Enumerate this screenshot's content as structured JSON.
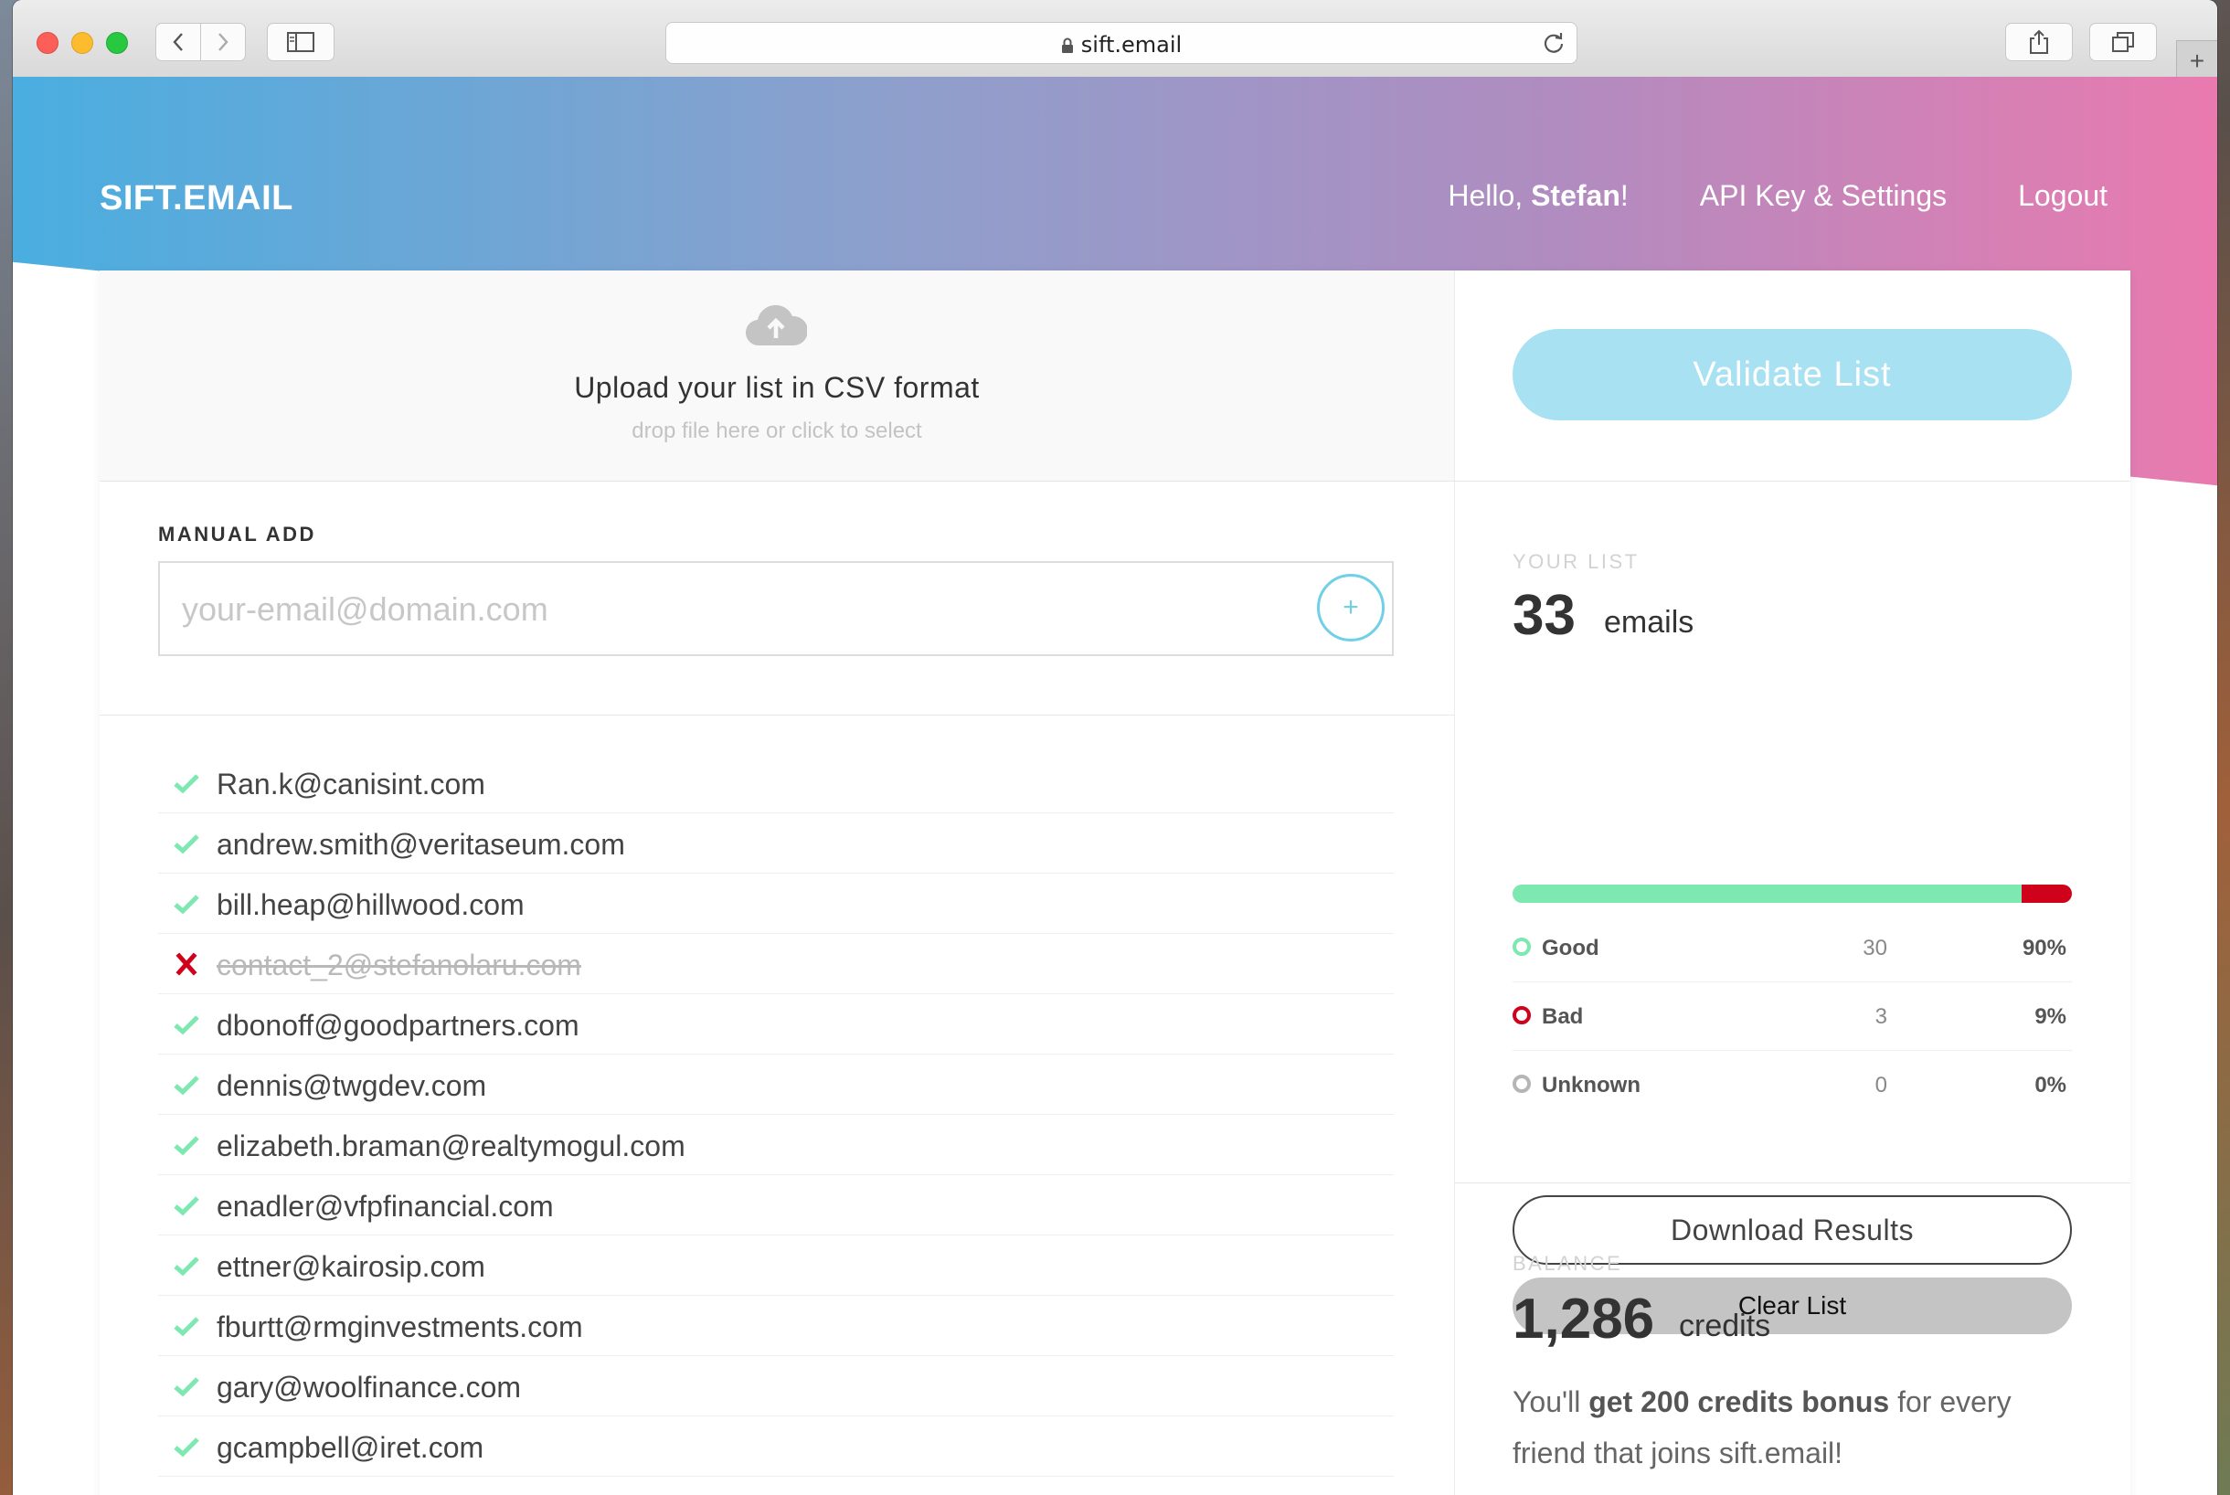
{
  "browser": {
    "url": "sift.email"
  },
  "header": {
    "logo": "SIFT.EMAIL",
    "greeting_prefix": "Hello, ",
    "user_name": "Stefan",
    "greeting_suffix": "!",
    "nav_settings": "API Key & Settings",
    "nav_logout": "Logout"
  },
  "upload": {
    "title": "Upload your list in CSV format",
    "hint": "drop file here or click to select"
  },
  "manual_add": {
    "label": "MANUAL ADD",
    "placeholder": "your-email@domain.com",
    "add_button": "+"
  },
  "emails": [
    {
      "address": "Ran.k@canisint.com",
      "status": "good"
    },
    {
      "address": "andrew.smith@veritaseum.com",
      "status": "good"
    },
    {
      "address": "bill.heap@hillwood.com",
      "status": "good"
    },
    {
      "address": "contact_2@stefanolaru.com",
      "status": "bad"
    },
    {
      "address": "dbonoff@goodpartners.com",
      "status": "good"
    },
    {
      "address": "dennis@twgdev.com",
      "status": "good"
    },
    {
      "address": "elizabeth.braman@realtymogul.com",
      "status": "good"
    },
    {
      "address": "enadler@vfpfinancial.com",
      "status": "good"
    },
    {
      "address": "ettner@kairosip.com",
      "status": "good"
    },
    {
      "address": "fburtt@rmginvestments.com",
      "status": "good"
    },
    {
      "address": "gary@woolfinance.com",
      "status": "good"
    },
    {
      "address": "gcampbell@iret.com",
      "status": "good"
    }
  ],
  "validate_button": "Validate List",
  "your_list": {
    "label": "YOUR LIST",
    "count": "33",
    "unit": "emails",
    "good_fraction": 0.91,
    "stats": [
      {
        "name": "Good",
        "count": "30",
        "percent": "90%",
        "color": "#7de8b0"
      },
      {
        "name": "Bad",
        "count": "3",
        "percent": "9%",
        "color": "#d0021b"
      },
      {
        "name": "Unknown",
        "count": "0",
        "percent": "0%",
        "color": "#b5b5b5"
      }
    ],
    "download_button": "Download Results",
    "clear_button": "Clear List"
  },
  "balance": {
    "label": "BALANCE",
    "amount": "1,286",
    "unit": "credits",
    "text_prefix": "You'll ",
    "text_bold": "get 200 credits bonus",
    "text_suffix": " for every friend that joins sift.email!"
  },
  "colors": {
    "accent": "#6fd0e6",
    "good": "#7de8b0",
    "bad": "#d0021b"
  }
}
